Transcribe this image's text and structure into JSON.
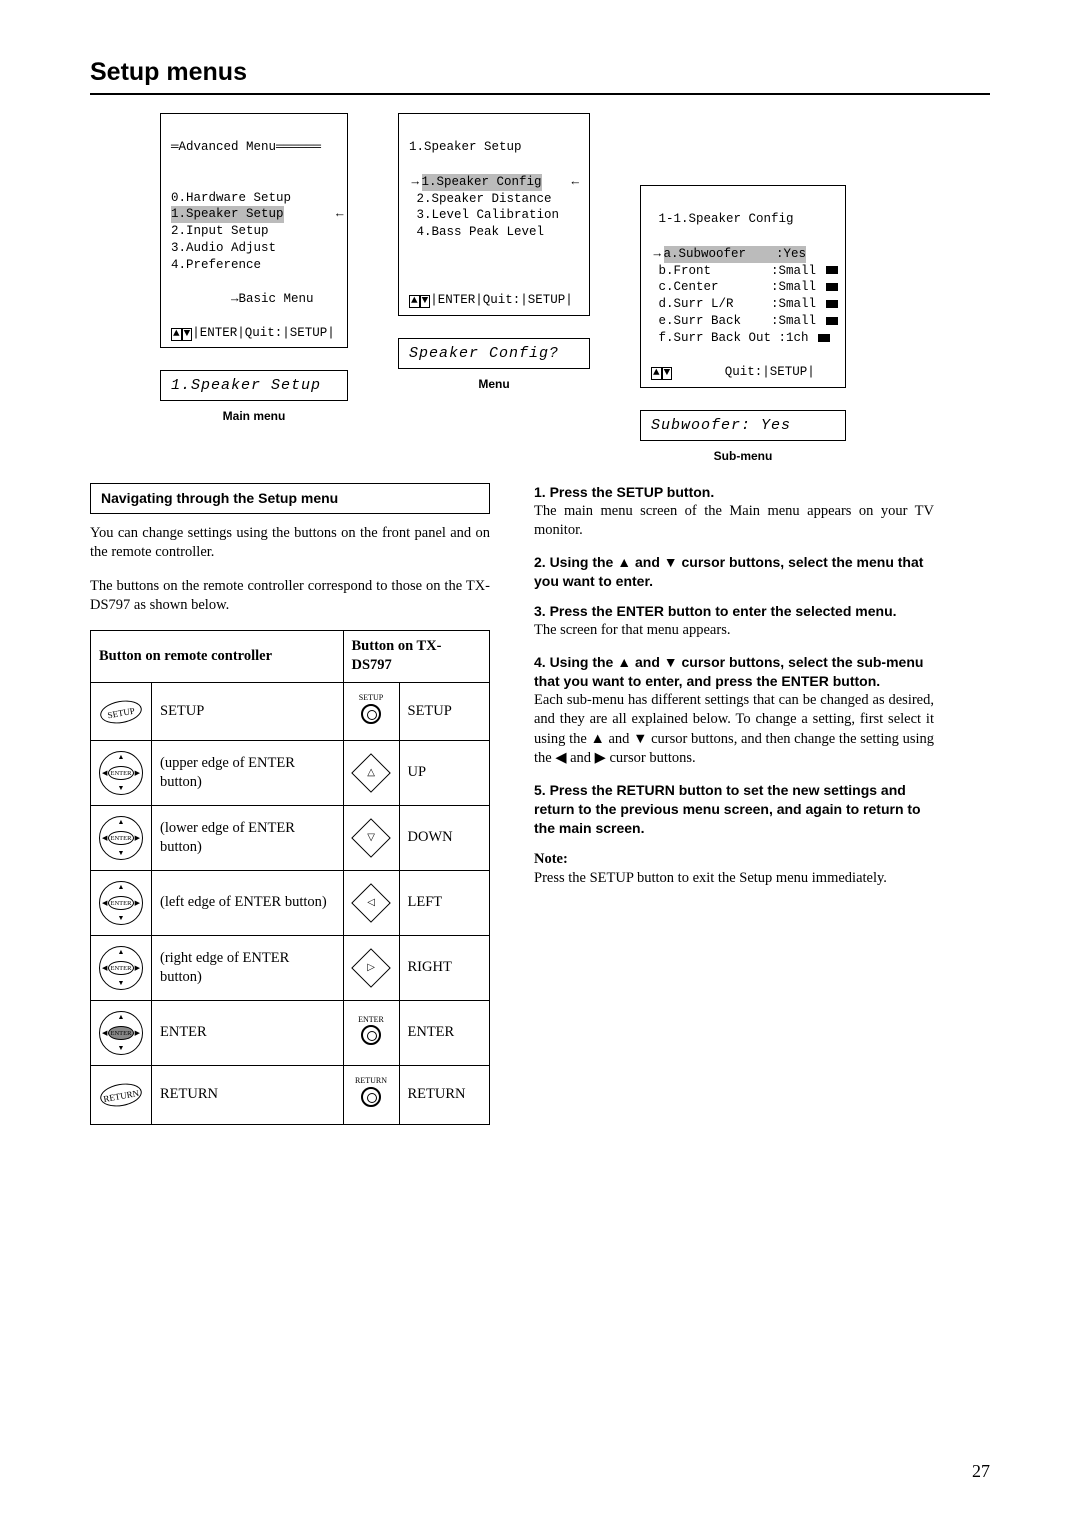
{
  "title": "Setup menus",
  "page_number": "27",
  "diagram": {
    "main": {
      "header": "Advanced Menu",
      "line0": "0.Hardware Setup",
      "line1": "1.Speaker Setup",
      "line2": "2.Input Setup",
      "line3": "3.Audio Adjust",
      "line4": "4.Preference",
      "basic": "→Basic Menu",
      "foot": "ENTER|Quit:|SETUP|",
      "lcd": "1.Speaker Setup",
      "label": "Main menu"
    },
    "menu": {
      "header": "1.Speaker Setup",
      "line1": "1.Speaker Config",
      "line2": "2.Speaker Distance",
      "line3": "3.Level Calibration",
      "line4": "4.Bass Peak Level",
      "foot": "ENTER|Quit:|SETUP|",
      "lcd": "Speaker Config?",
      "label": "Menu"
    },
    "sub": {
      "header": "1-1.Speaker Config",
      "a": "a.Subwoofer    :Yes",
      "b": "b.Front        :Small",
      "c": "c.Center       :Small",
      "d": "d.Surr L/R     :Small",
      "e": "e.Surr Back    :Small",
      "f": "f.Surr Back Out :1ch",
      "foot": "Quit:|SETUP|",
      "lcd": "Subwoofer:   Yes",
      "label": "Sub-menu"
    }
  },
  "nav": {
    "heading": "Navigating through the Setup menu",
    "p1": "You can change settings using the buttons on the front panel and on the remote controller.",
    "p2": "The buttons on the remote controller correspond to those on the TX-DS797 as shown below."
  },
  "table": {
    "h1": "Button on remote controller",
    "h2": "Button on TX-DS797",
    "rows": [
      {
        "rc_label": "SETUP",
        "rc_desc": "SETUP",
        "dev_lbl": "SETUP",
        "dev_desc": "SETUP"
      },
      {
        "rc_label": "ENTER",
        "rc_desc": "(upper edge of ENTER button)",
        "dev_lbl": "",
        "dev_desc": "UP",
        "dir": "△"
      },
      {
        "rc_label": "ENTER",
        "rc_desc": "(lower edge of ENTER button)",
        "dev_lbl": "",
        "dev_desc": "DOWN",
        "dir": "▽"
      },
      {
        "rc_label": "ENTER",
        "rc_desc": "(left edge of ENTER button)",
        "dev_lbl": "",
        "dev_desc": "LEFT",
        "dir": "◁"
      },
      {
        "rc_label": "ENTER",
        "rc_desc": "(right edge of ENTER button)",
        "dev_lbl": "",
        "dev_desc": "RIGHT",
        "dir": "▷"
      },
      {
        "rc_label": "ENTER",
        "rc_desc": "ENTER",
        "dev_lbl": "ENTER",
        "dev_desc": "ENTER"
      },
      {
        "rc_label": "RETURN",
        "rc_desc": "RETURN",
        "dev_lbl": "RETURN",
        "dev_desc": "RETURN"
      }
    ]
  },
  "steps": {
    "s1h": "1.  Press the SETUP button.",
    "s1b": "The main menu screen of the Main menu appears on your TV monitor.",
    "s2h": "2.  Using the ▲ and ▼ cursor buttons, select the menu that you want to enter.",
    "s3h": "3.  Press the ENTER button to enter the selected menu.",
    "s3b": "The screen for that menu appears.",
    "s4h": "4.  Using the ▲ and ▼ cursor buttons, select the sub-menu that you want to enter, and press the ENTER button.",
    "s4b": "Each sub-menu has different settings that can be changed as desired, and they are all explained below. To change a setting, first select it using the ▲ and ▼ cursor buttons, and then change the setting using the ◀ and ▶ cursor buttons.",
    "s5h": "5.  Press the RETURN button to set the new settings and return to the previous menu screen, and again to return to the main screen.",
    "noteh": "Note:",
    "noteb": "Press the SETUP button to exit the Setup menu immediately."
  }
}
